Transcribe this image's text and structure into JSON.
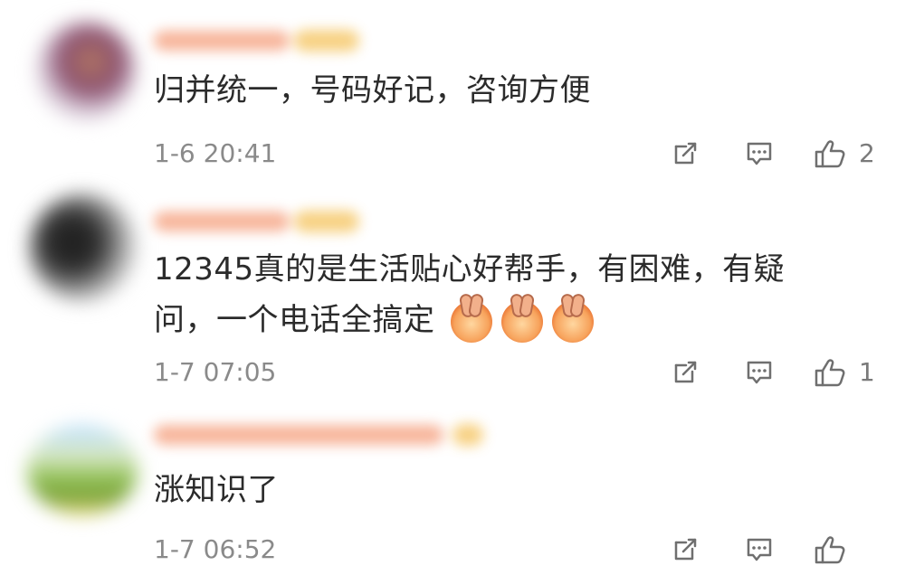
{
  "comments": [
    {
      "text": "归并统一，号码好记，咨询方便",
      "timestamp": "1-6 20:41",
      "like_count": "2",
      "emojis": [],
      "icons": {
        "share": "share-icon",
        "comment": "comment-icon",
        "like": "thumbs-up-icon"
      }
    },
    {
      "text": "12345真的是生活贴心好帮手，有困难，有疑问，一个电话全搞定",
      "timestamp": "1-7 07:05",
      "like_count": "1",
      "emojis": [
        "clapping-hands-emoji",
        "clapping-hands-emoji",
        "clapping-hands-emoji"
      ],
      "icons": {
        "share": "share-icon",
        "comment": "comment-icon",
        "like": "thumbs-up-icon"
      }
    },
    {
      "text": "涨知识了",
      "timestamp": "1-7 06:52",
      "like_count": "",
      "emojis": [],
      "icons": {
        "share": "share-icon",
        "comment": "comment-icon",
        "like": "thumbs-up-icon"
      }
    }
  ],
  "colors": {
    "text": "#2b2b2b",
    "meta": "#8a8a8a",
    "icon": "#6f6f6f",
    "background": "#ffffff"
  }
}
